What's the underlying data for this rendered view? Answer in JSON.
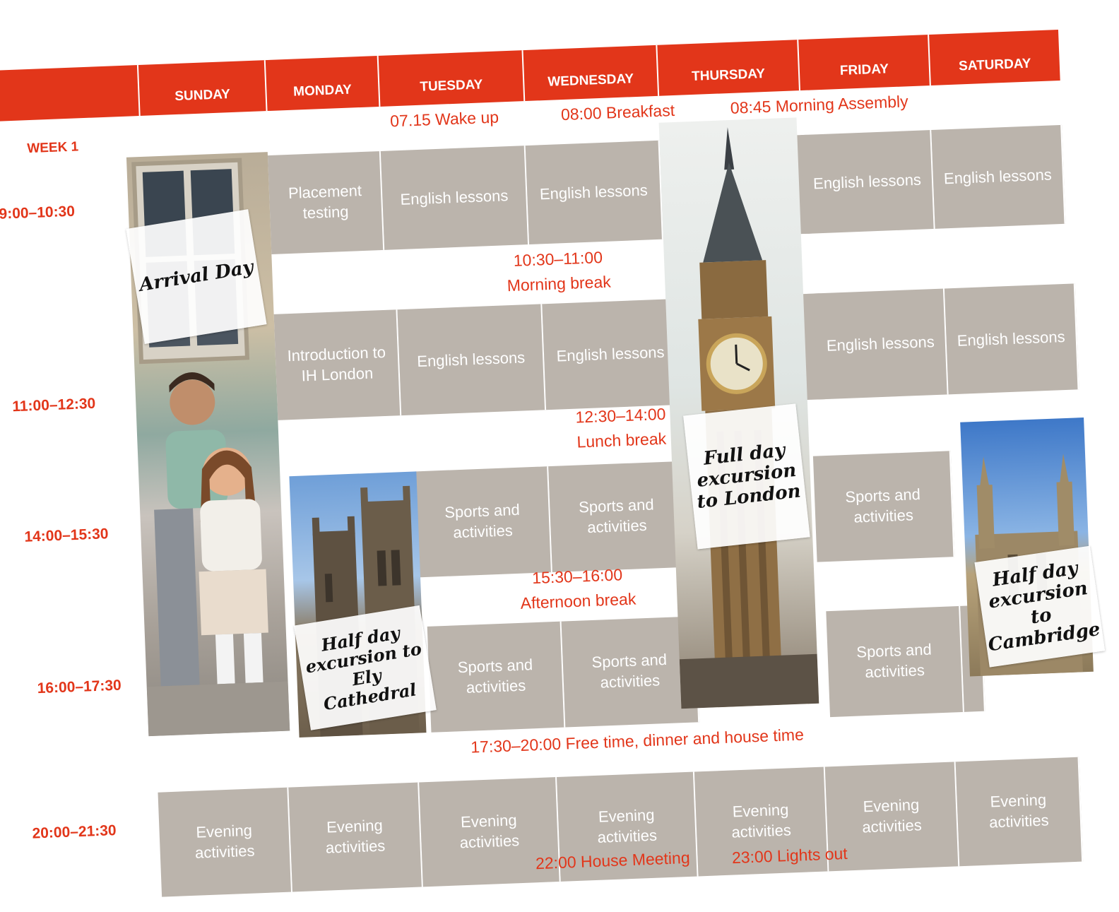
{
  "days": [
    "SUNDAY",
    "MONDAY",
    "TUESDAY",
    "WEDNESDAY",
    "THURSDAY",
    "FRIDAY",
    "SATURDAY"
  ],
  "week_label": "WEEK 1",
  "times": {
    "t1": "09:00–10:30",
    "t2": "11:00–12:30",
    "t3": "14:00–15:30",
    "t4": "16:00–17:30",
    "t5": "20:00–21:30"
  },
  "morning_routine": {
    "wake": "07.15 Wake up",
    "breakfast": "08:00 Breakfast",
    "assembly": "08:45 Morning Assembly"
  },
  "breaks": {
    "morning_time": "10:30–11:00",
    "morning_label": "Morning break",
    "lunch_time": "12:30–14:00",
    "lunch_label": "Lunch break",
    "afternoon_time": "15:30–16:00",
    "afternoon_label": "Afternoon break"
  },
  "free_time": "17:30–20:00 Free time, dinner and house time",
  "night": {
    "meeting": "22:00 House Meeting",
    "lights": "23:00 Lights out"
  },
  "sessions": {
    "placement": "Placement testing",
    "english": "English lessons",
    "intro": "Introduction to IH London",
    "sports": "Sports and activities",
    "evening": "Evening activities"
  },
  "notes": {
    "arrival": "Arrival Day",
    "ely": "Half day excursion to Ely Cathedral",
    "london": "Full day excursion to London",
    "cambridge": "Half day excursion to Cambridge"
  },
  "colors": {
    "accent": "#e2361a",
    "cell": "#bbb4ac"
  }
}
